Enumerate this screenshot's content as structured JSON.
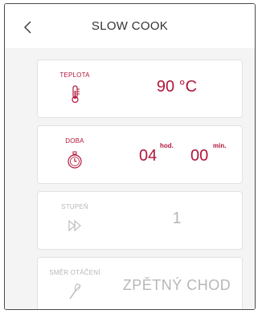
{
  "header": {
    "title": "SLOW COOK",
    "back_icon": "chevron-left-icon"
  },
  "colors": {
    "accent": "#b1163a",
    "disabled": "#b7b7b7",
    "panel_bg": "#f4f4f4"
  },
  "settings": {
    "temperature": {
      "label": "TEPLOTA",
      "value": "90 °C",
      "icon": "thermometer-icon"
    },
    "time": {
      "label": "DOBA",
      "hours": "04",
      "hours_unit": "hod.",
      "minutes": "00",
      "minutes_unit": "min.",
      "icon": "stopwatch-icon"
    },
    "level": {
      "label": "STUPEŇ",
      "value": "1",
      "icon": "fast-forward-icon"
    },
    "direction": {
      "label": "SMĚR OTÁČENÍ",
      "value": "ZPĚTNÝ CHOD",
      "icon": "whisk-icon"
    }
  }
}
